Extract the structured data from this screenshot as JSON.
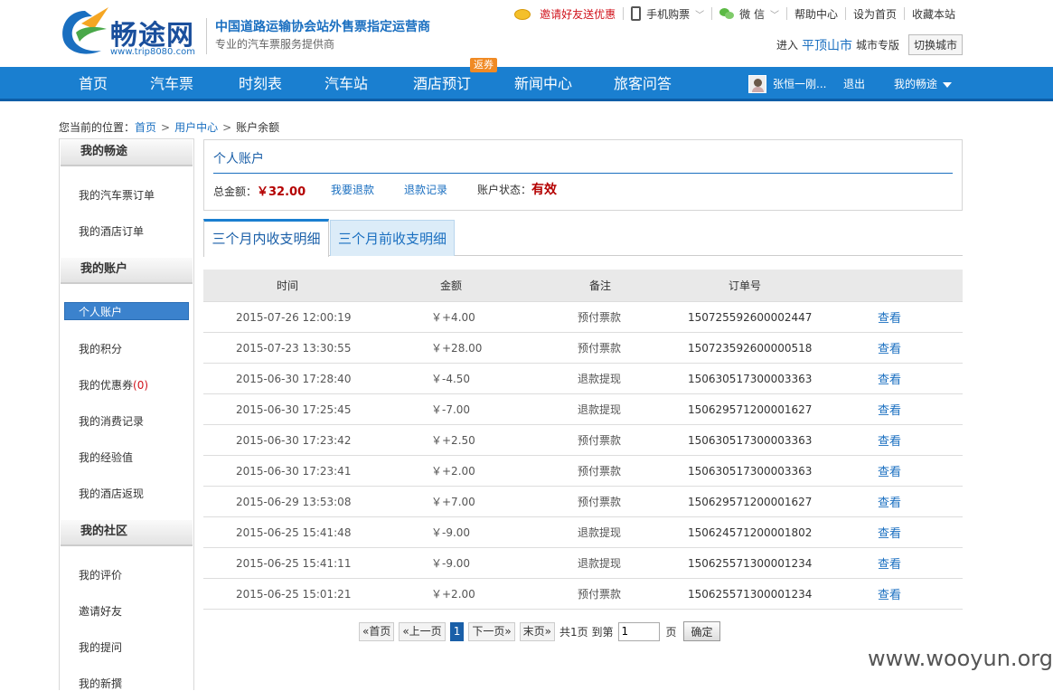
{
  "header": {
    "logo_text": "畅途网",
    "logo_url": "www.trip8080.com",
    "slogan_main": "中国道路运输协会站外售票指定运营商",
    "slogan_sub": "专业的汽车票服务提供商",
    "toplinks": {
      "invite": "邀请好友送优惠",
      "mobile": "手机购票",
      "wechat": "微 信",
      "help": "帮助中心",
      "homepage": "设为首页",
      "favorite": "收藏本站"
    },
    "city": {
      "prefix": "进入",
      "name": "平顶山市",
      "suffix": "城市专版",
      "switch_label": "切换城市"
    }
  },
  "nav": {
    "items": [
      "首页",
      "汽车票",
      "时刻表",
      "汽车站",
      "酒店预订",
      "新闻中心",
      "旅客问答"
    ],
    "badge": "返券",
    "user_name": "张恒一刚...",
    "logout": "退出",
    "my_account": "我的畅途"
  },
  "breadcrumb": {
    "prefix": "您当前的位置：",
    "home": "首页",
    "user_center": "用户中心",
    "current": "账户余额",
    "sep": ">"
  },
  "sidebar": {
    "section1": "我的畅途",
    "s1_items": [
      "我的汽车票订单",
      "我的酒店订单"
    ],
    "section2": "我的账户",
    "active_item": "个人账户",
    "s2_items": [
      "我的积分",
      "我的优惠券",
      "我的消费记录",
      "我的经验值",
      "我的酒店返现"
    ],
    "coupon_count": "(0)",
    "section3": "我的社区",
    "s3_items": [
      "我的评价",
      "邀请好友",
      "我的提问",
      "我的新撰"
    ]
  },
  "account": {
    "title": "个人账户",
    "total_label": "总金额：",
    "total_value": "￥32.00",
    "refund_link": "我要退款",
    "refund_record": "退款记录",
    "status_label": "账户状态：",
    "status_value": "有效"
  },
  "tabs": {
    "active": "三个月内收支明细",
    "inactive": "三个月前收支明细"
  },
  "table": {
    "headers": [
      "时间",
      "金额",
      "备注",
      "订单号"
    ],
    "view_label": "查看",
    "rows": [
      {
        "time": "2015-07-26 12:00:19",
        "amount": "￥+4.00",
        "note": "预付票款",
        "order": "150725592600002447"
      },
      {
        "time": "2015-07-23 13:30:55",
        "amount": "￥+28.00",
        "note": "预付票款",
        "order": "150723592600000518"
      },
      {
        "time": "2015-06-30 17:28:40",
        "amount": "￥-4.50",
        "note": "退款提现",
        "order": "150630517300003363"
      },
      {
        "time": "2015-06-30 17:25:45",
        "amount": "￥-7.00",
        "note": "退款提现",
        "order": "150629571200001627"
      },
      {
        "time": "2015-06-30 17:23:42",
        "amount": "￥+2.50",
        "note": "预付票款",
        "order": "150630517300003363"
      },
      {
        "time": "2015-06-30 17:23:41",
        "amount": "￥+2.00",
        "note": "预付票款",
        "order": "150630517300003363"
      },
      {
        "time": "2015-06-29 13:53:08",
        "amount": "￥+7.00",
        "note": "预付票款",
        "order": "150629571200001627"
      },
      {
        "time": "2015-06-25 15:41:48",
        "amount": "￥-9.00",
        "note": "退款提现",
        "order": "150624571200001802"
      },
      {
        "time": "2015-06-25 15:41:11",
        "amount": "￥-9.00",
        "note": "退款提现",
        "order": "150625571300001234"
      },
      {
        "time": "2015-06-25 15:01:21",
        "amount": "￥+2.00",
        "note": "预付票款",
        "order": "150625571300001234"
      }
    ]
  },
  "pager": {
    "first": "«首页",
    "prev": "«上一页",
    "current": "1",
    "next": "下一页»",
    "last": "末页»",
    "total_text": "共1页 到第",
    "input_value": "1",
    "page_unit": "页",
    "confirm": "确定"
  },
  "watermark": "www.wooyun.org",
  "colors": {
    "nav_blue": "#1a7fd0",
    "link_blue": "#1a6fc0",
    "amount_red": "#b40000",
    "active_blue": "#3b82cd"
  }
}
